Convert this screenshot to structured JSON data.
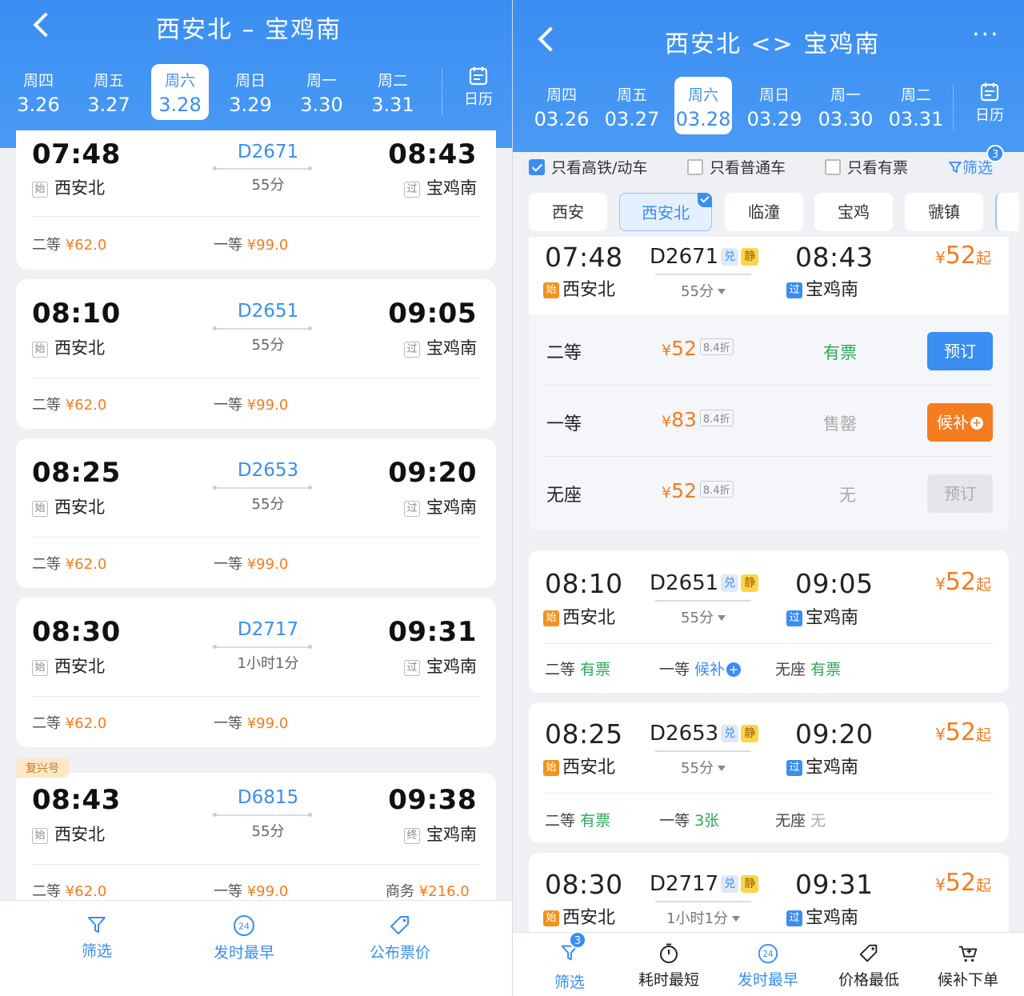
{
  "left": {
    "title": "西安北 – 宝鸡南",
    "days": [
      {
        "wd": "周四",
        "dt": "3.26"
      },
      {
        "wd": "周五",
        "dt": "3.27"
      },
      {
        "wd": "周六",
        "dt": "3.28"
      },
      {
        "wd": "周日",
        "dt": "3.29"
      },
      {
        "wd": "周一",
        "dt": "3.30"
      },
      {
        "wd": "周二",
        "dt": "3.31"
      }
    ],
    "selected_day": 2,
    "calendar_label": "日历",
    "trains": [
      {
        "dep": "07:48",
        "arr": "08:43",
        "no": "D2671",
        "dur": "55分",
        "from_tag": "始",
        "from": "西安北",
        "to_tag": "过",
        "to": "宝鸡南",
        "p2_label": "二等",
        "p2": "¥62.0",
        "p1_label": "一等",
        "p1": "¥99.0"
      },
      {
        "dep": "08:10",
        "arr": "09:05",
        "no": "D2651",
        "dur": "55分",
        "from_tag": "始",
        "from": "西安北",
        "to_tag": "过",
        "to": "宝鸡南",
        "p2_label": "二等",
        "p2": "¥62.0",
        "p1_label": "一等",
        "p1": "¥99.0"
      },
      {
        "dep": "08:25",
        "arr": "09:20",
        "no": "D2653",
        "dur": "55分",
        "from_tag": "始",
        "from": "西安北",
        "to_tag": "过",
        "to": "宝鸡南",
        "p2_label": "二等",
        "p2": "¥62.0",
        "p1_label": "一等",
        "p1": "¥99.0"
      },
      {
        "dep": "08:30",
        "arr": "09:31",
        "no": "D2717",
        "dur": "1小时1分",
        "from_tag": "始",
        "from": "西安北",
        "to_tag": "过",
        "to": "宝鸡南",
        "p2_label": "二等",
        "p2": "¥62.0",
        "p1_label": "一等",
        "p1": "¥99.0"
      },
      {
        "badge": "复兴号",
        "dep": "08:43",
        "arr": "09:38",
        "no": "D6815",
        "dur": "55分",
        "from_tag": "始",
        "from": "西安北",
        "to_tag": "终",
        "to": "宝鸡南",
        "p2_label": "二等",
        "p2": "¥62.0",
        "p1_label": "一等",
        "p1": "¥99.0",
        "pb_label": "商务",
        "pb": "¥216.0"
      }
    ],
    "tabs": [
      "筛选",
      "发时最早",
      "公布票价"
    ],
    "clock_icon_text": "24"
  },
  "right": {
    "title": "西安北 <> 宝鸡南",
    "more": "···",
    "days": [
      {
        "wd": "周四",
        "dt": "03.26"
      },
      {
        "wd": "周五",
        "dt": "03.27"
      },
      {
        "wd": "周六",
        "dt": "03.28"
      },
      {
        "wd": "周日",
        "dt": "03.29"
      },
      {
        "wd": "周一",
        "dt": "03.30"
      },
      {
        "wd": "周二",
        "dt": "03.31"
      }
    ],
    "selected_day": 2,
    "calendar_label": "日历",
    "filters": {
      "gt": "只看高铁/动车",
      "normal": "只看普通车",
      "avail": "只看有票",
      "filter": "筛选",
      "filter_count": "3"
    },
    "stations": [
      "西安",
      "西安北",
      "临潼",
      "宝鸡",
      "虢镇"
    ],
    "selected_station": 1,
    "expanded": {
      "dep": "07:48",
      "arr": "08:43",
      "no": "D2671",
      "tag_dui": "兑",
      "tag_jing": "静",
      "dur": "55分",
      "from_tag": "始",
      "from": "西安北",
      "to_tag": "过",
      "to": "宝鸡南",
      "price_y": "¥",
      "price_n": "52",
      "price_q": "起",
      "seats": [
        {
          "name": "二等",
          "y": "¥",
          "price": "52",
          "disc": "8.4折",
          "avail": "有票",
          "btn": "预订"
        },
        {
          "name": "一等",
          "y": "¥",
          "price": "83",
          "disc": "8.4折",
          "avail": "售罄",
          "btn": "候补"
        },
        {
          "name": "无座",
          "y": "¥",
          "price": "52",
          "disc": "8.4折",
          "avail": "无",
          "btn": "预订"
        }
      ]
    },
    "trains": [
      {
        "dep": "08:10",
        "arr": "09:05",
        "no": "D2651",
        "dur": "55分",
        "from_tag": "始",
        "from": "西安北",
        "to_tag": "过",
        "to": "宝鸡南",
        "s1": "二等",
        "v1": "有票",
        "s2": "一等",
        "v2": "候补",
        "s3": "无座",
        "v3": "有票"
      },
      {
        "dep": "08:25",
        "arr": "09:20",
        "no": "D2653",
        "dur": "55分",
        "from_tag": "始",
        "from": "西安北",
        "to_tag": "过",
        "to": "宝鸡南",
        "s1": "二等",
        "v1": "有票",
        "s2": "一等",
        "v2": "3张",
        "s3": "无座",
        "v3": "无"
      },
      {
        "dep": "08:30",
        "arr": "09:31",
        "no": "D2717",
        "dur": "1小时1分",
        "from_tag": "始",
        "from": "西安北",
        "to_tag": "过",
        "to": "宝鸡南"
      }
    ],
    "tag_dui": "兑",
    "tag_jing": "静",
    "price_y": "¥",
    "price_n": "52",
    "price_q": "起",
    "tabs": [
      "筛选",
      "耗时最短",
      "发时最早",
      "价格最低",
      "候补下单"
    ],
    "tab_badge": "3",
    "clock_icon_text": "24",
    "colors": {
      "primary": "#3a8ef2",
      "orange": "#f57c1f",
      "green": "#2eaa55"
    }
  }
}
